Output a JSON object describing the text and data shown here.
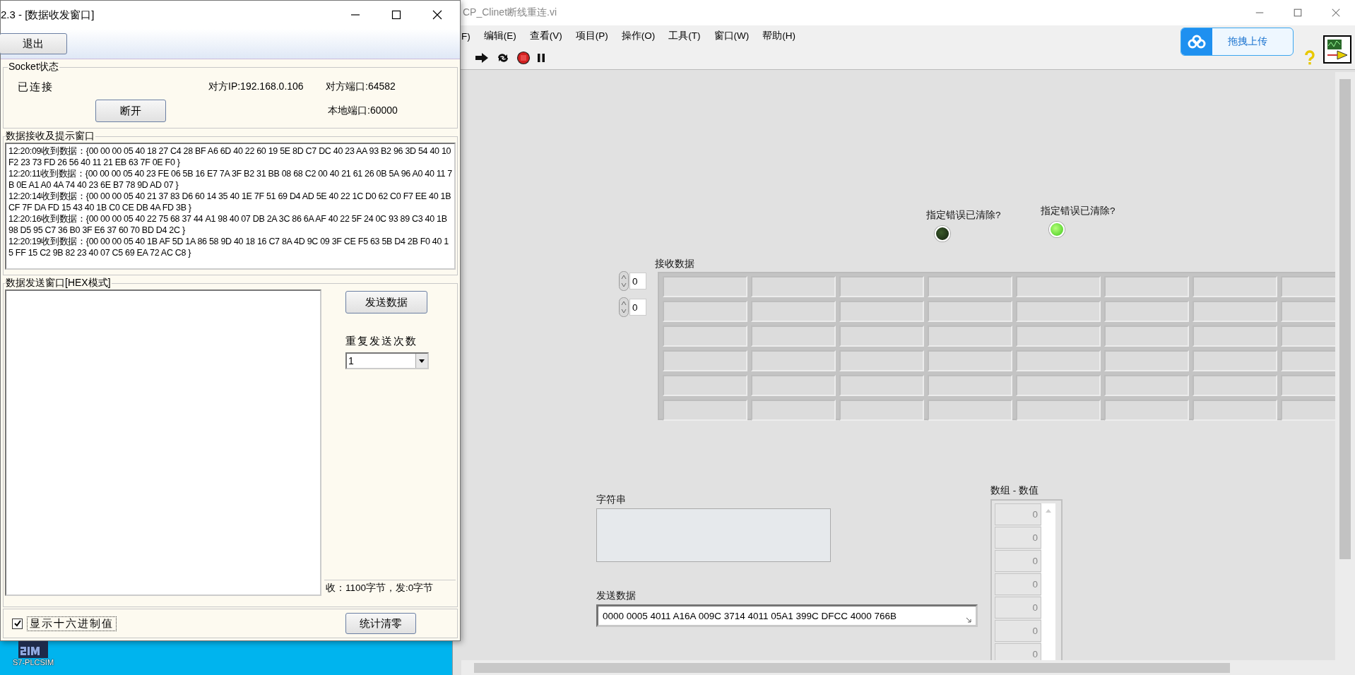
{
  "send_receive_window": {
    "title": "2.3 - [数据收发窗口]",
    "exit_button": "退出",
    "socket_group": {
      "legend": "Socket状态",
      "status": "已连接",
      "remote_ip": "对方IP:192.168.0.106",
      "remote_port": "对方端口:64582",
      "disconnect_button": "断开",
      "local_port": "本地端口:60000"
    },
    "receive_group": {
      "legend": "数据接收及提示窗口",
      "log": [
        "12:20:09收到数据：{00 00 00 05 40 18 27 C4 28 BF A6 6D 40 22 60 19 5E 8D C7 DC 40 23 AA 93 B2 96 3D 54 40 10 F2 23 73 FD 26 56 40 11 21 EB 63 7F 0E F0 }",
        "12:20:11收到数据：{00 00 00 05 40 23 FE 06 5B 16 E7 7A 3F B2 31 BB 08 68 C2 00 40 21 61 26 0B 5A 96 A0 40 11 7B 0E A1 A0 4A 74 40 23 6E B7 78 9D AD 07 }",
        "12:20:14收到数据：{00 00 00 05 40 21 37 83 D6 60 14 35 40 1E 7F 51 69 D4 AD 5E 40 22 1C D0 62 C0 F7 EE 40 1B CF 7F DA FD 15 43 40 1B C0 CE DB 4A FD 3B }",
        "12:20:16收到数据：{00 00 00 05 40 22 75 68 37 44 A1 98 40 07 DB 2A 3C 86 6A AF 40 22 5F 24 0C 93 89 C3 40 1B 98 D5 95 C7 36 B0 3F E6 37 60 70 BD D4 2C }",
        "12:20:19收到数据：{00 00 00 05 40 1B AF 5D 1A 86 58 9D 40 18 16 C7 8A 4D 9C 09 3F CE F5 63 5B D4 2B F0 40 15 FF 15 C2 9B 82 23 40 07 C5 69 EA 72 AC C8 }"
      ]
    },
    "send_group": {
      "legend": "数据发送窗口[HEX模式]",
      "send_button": "发送数据",
      "repeat_label": "重复发送次数",
      "repeat_value": "1",
      "counter": "收：1100字节，发:0字节"
    },
    "hex_checkbox": {
      "label": "显示十六进制值",
      "checked": true
    },
    "clear_button": "统计清零"
  },
  "desktop": {
    "icon_label": "S7-PLCSIM"
  },
  "labview": {
    "title": "CP_Clinet断线重连.vi",
    "menu": [
      "F)",
      "编辑(E)",
      "查看(V)",
      "项目(P)",
      "操作(O)",
      "工具(T)",
      "窗口(W)",
      "帮助(H)"
    ],
    "upload_button": "拖拽上传",
    "leds": [
      {
        "label": "指定错误已清除?",
        "on": false
      },
      {
        "label": "指定错误已清除?",
        "on": true
      }
    ],
    "receive_array": {
      "label": "接收数据",
      "indices": [
        "0",
        "0"
      ]
    },
    "string_indicator": {
      "label": "字符串"
    },
    "send_data": {
      "label": "发送数据",
      "value": "0000 0005 4011 A16A 009C 3714 4011 05A1 399C DFCC 4000 766B"
    },
    "numeric_array": {
      "label": "数组 - 数值",
      "values": [
        "0",
        "0",
        "0",
        "0",
        "0",
        "0",
        "0"
      ]
    }
  }
}
